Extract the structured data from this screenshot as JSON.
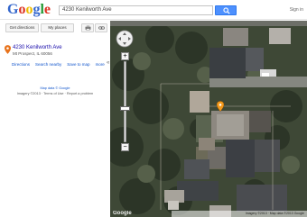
{
  "brand": {
    "logo_letters": [
      "G",
      "o",
      "o",
      "g",
      "l",
      "e"
    ],
    "logo_colors": [
      "#3366cc",
      "#dd3322",
      "#eebb00",
      "#3366cc",
      "#229933",
      "#dd3322"
    ]
  },
  "search": {
    "value": "4230 Kenilworth Ave",
    "button_icon": "search-icon"
  },
  "header_links": "Sign in",
  "toolbar": {
    "get_directions": "Get directions",
    "my_places": "My places",
    "print_icon": "print-icon",
    "link_icon": "link-icon"
  },
  "place": {
    "address": "4230 Kenilworth Ave",
    "city": "Mt Prospect, IL 60056",
    "links": [
      "Directions",
      "Search nearby",
      "Save to map",
      "more"
    ]
  },
  "legal": {
    "line1": "Map data © Google",
    "line2": "Imagery ©2013 · Terms of Use · Report a problem"
  },
  "map": {
    "footer": "Imagery ©2013 · Map data ©2013 Google",
    "watermark": "Google",
    "marker_icon": "map-pin-icon",
    "zoom_in": "+",
    "zoom_out": "−",
    "collapse": "«"
  }
}
